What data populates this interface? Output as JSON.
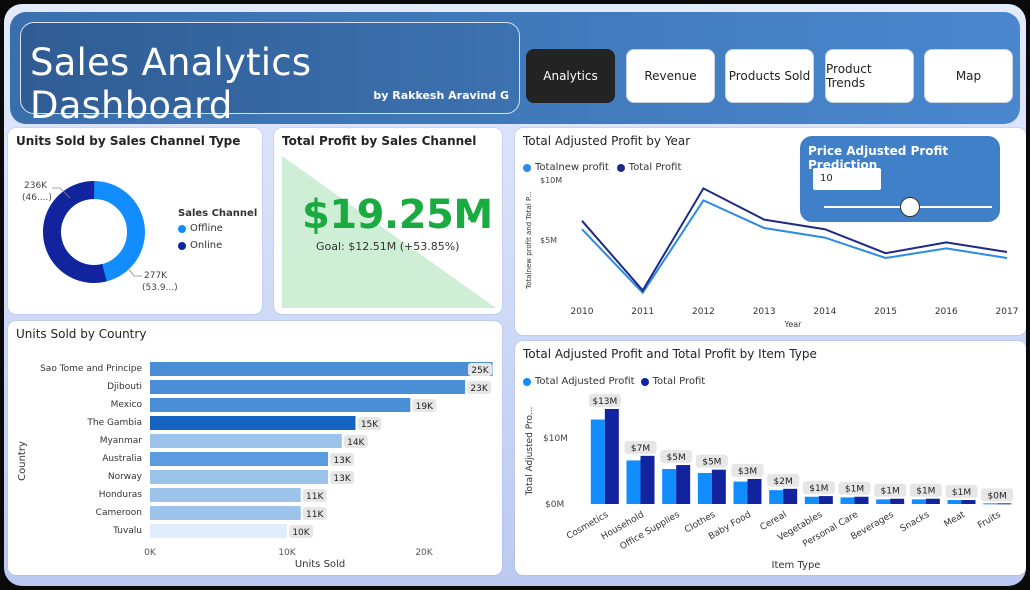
{
  "header": {
    "title": "Sales Analytics Dashboard",
    "subtitle": "by Rakkesh Aravind G",
    "nav": [
      {
        "label": "Analytics",
        "active": true
      },
      {
        "label": "Revenue",
        "active": false
      },
      {
        "label": "Products Sold",
        "active": false
      },
      {
        "label": "Product Trends",
        "active": false
      },
      {
        "label": "Map",
        "active": false
      }
    ]
  },
  "donut": {
    "title": "Units Sold by Sales Channel Type",
    "legend_title": "Sales Channel",
    "offline_label": "Offline",
    "online_label": "Online",
    "offline_value_label": "236K",
    "offline_pct_label": "(46....)",
    "online_value_label": "277K",
    "online_pct_label": "(53.9...)",
    "colors": {
      "offline": "#118dff",
      "online": "#12239e"
    }
  },
  "kpi": {
    "title": "Total Profit by Sales Channel",
    "value": "$19.25M",
    "check": "✓",
    "goal": "Goal: $12.51M (+53.85%)",
    "color": "#1aab40"
  },
  "country": {
    "title": "Units Sold by Country",
    "y_axis_label": "Country",
    "x_axis_label": "Units Sold",
    "x_ticks": [
      "0K",
      "10K",
      "20K"
    ]
  },
  "year": {
    "title": "Total Adjusted Profit by Year",
    "legend_a": "Totalnew profit",
    "legend_b": "Total Profit",
    "y_axis_label": "Totalnew profit and Total P...",
    "x_axis_label": "Year",
    "y_ticks": [
      "$10M",
      "$5M"
    ]
  },
  "prediction": {
    "title": "Price Adjusted Profit Prediction",
    "input_value": "10"
  },
  "items": {
    "title": "Total Adjusted Profit and Total Profit by Item Type",
    "legend_a": "Total Adjusted Profit",
    "legend_b": "Total Profit",
    "y_axis_label": "Total Adjusted Pro...",
    "x_axis_label": "Item Type",
    "y_ticks": [
      "$10M",
      "$0M"
    ]
  },
  "chart_data": [
    {
      "type": "pie",
      "title": "Units Sold by Sales Channel Type",
      "categories": [
        "Offline",
        "Online"
      ],
      "values": [
        236,
        277
      ],
      "unit": "K"
    },
    {
      "type": "bar",
      "title": "Units Sold by Country",
      "categories": [
        "Sao Tome and Principe",
        "Djibouti",
        "Mexico",
        "The Gambia",
        "Myanmar",
        "Australia",
        "Norway",
        "Honduras",
        "Cameroon",
        "Tuvalu"
      ],
      "values": [
        25,
        23,
        19,
        15,
        14,
        13,
        13,
        11,
        11,
        10
      ],
      "labels": [
        "25K",
        "23K",
        "19K",
        "15K",
        "14K",
        "13K",
        "13K",
        "11K",
        "11K",
        "10K"
      ],
      "bar_colors": [
        "#4a8fd6",
        "#4a8fd6",
        "#4a8fd6",
        "#1565c0",
        "#9cc3ea",
        "#5b9be0",
        "#9cc3ea",
        "#9cc3ea",
        "#9cc3ea",
        "#e0edfb"
      ],
      "xlabel": "Units Sold",
      "ylabel": "Country",
      "xlim": [
        0,
        26
      ]
    },
    {
      "type": "line",
      "title": "Total Adjusted Profit by Year",
      "x": [
        "2010",
        "2011",
        "2012",
        "2013",
        "2014",
        "2015",
        "2016",
        "2017"
      ],
      "series": [
        {
          "name": "Totalnew profit",
          "color": "#2b8ae6",
          "values": [
            5.9,
            0.6,
            8.3,
            6.0,
            5.2,
            3.5,
            4.3,
            3.5
          ]
        },
        {
          "name": "Total Profit",
          "color": "#1e2a85",
          "values": [
            6.6,
            0.8,
            9.3,
            6.7,
            5.9,
            3.9,
            4.8,
            4.0
          ]
        }
      ],
      "xlabel": "Year",
      "ylabel": "Totalnew profit and Total P...",
      "ylim": [
        0,
        11
      ]
    },
    {
      "type": "bar",
      "title": "Total Adjusted Profit and Total Profit by Item Type",
      "categories": [
        "Cosmetics",
        "Household",
        "Office Supplies",
        "Clothes",
        "Baby Food",
        "Cereal",
        "Vegetables",
        "Personal Care",
        "Beverages",
        "Snacks",
        "Meat",
        "Fruits"
      ],
      "series": [
        {
          "name": "Total Adjusted Profit",
          "color": "#118dff",
          "values": [
            12.8,
            6.6,
            5.3,
            4.7,
            3.4,
            2.1,
            1.1,
            1.0,
            0.7,
            0.7,
            0.6,
            0.1
          ]
        },
        {
          "name": "Total Profit",
          "color": "#12239e",
          "values": [
            14.4,
            7.3,
            5.9,
            5.2,
            3.8,
            2.3,
            1.2,
            1.1,
            0.8,
            0.8,
            0.6,
            0.1
          ]
        }
      ],
      "labels": [
        "$13M",
        "$7M",
        "$5M",
        "$5M",
        "$3M",
        "$2M",
        "$1M",
        "$1M",
        "$1M",
        "$1M",
        "$1M",
        "$0M"
      ],
      "xlabel": "Item Type",
      "ylabel": "Total Adjusted Pro...",
      "ylim": [
        0,
        15
      ]
    }
  ]
}
